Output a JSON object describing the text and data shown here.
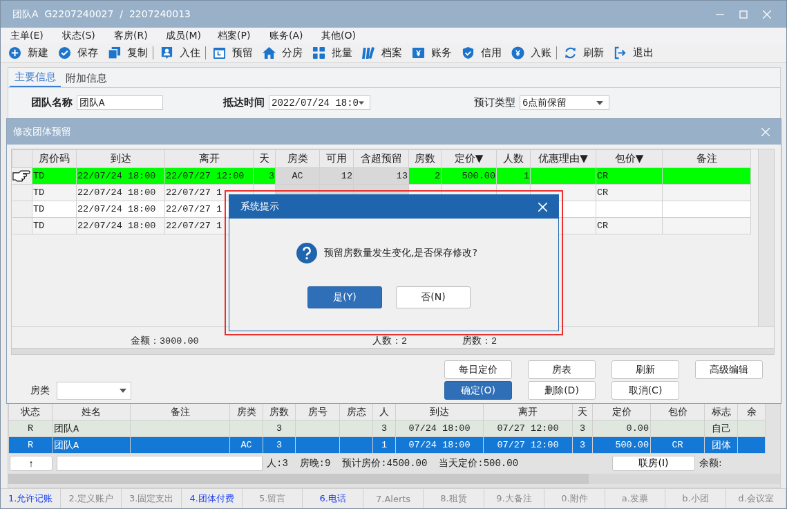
{
  "window": {
    "title": "团队A  G2207240027  /  2207240013"
  },
  "menu": [
    "主单(E)",
    "状态(S)",
    "客房(R)",
    "成员(M)",
    "档案(P)",
    "账务(A)",
    "其他(O)"
  ],
  "toolbar": [
    {
      "label": "新建",
      "divider_after": false
    },
    {
      "label": "保存",
      "divider_after": false
    },
    {
      "label": "复制",
      "divider_after": true
    },
    {
      "label": "入住",
      "divider_after": true
    },
    {
      "label": "预留",
      "divider_after": false
    },
    {
      "label": "分房",
      "divider_after": false
    },
    {
      "label": "批量",
      "divider_after": false
    },
    {
      "label": "档案",
      "divider_after": false
    },
    {
      "label": "账务",
      "divider_after": false
    },
    {
      "label": "信用",
      "divider_after": false
    },
    {
      "label": "入账",
      "divider_after": true
    },
    {
      "label": "刷新",
      "divider_after": false
    },
    {
      "label": "退出",
      "divider_after": false
    }
  ],
  "tabs": [
    {
      "label": "主要信息",
      "selected": true
    },
    {
      "label": "附加信息",
      "selected": false
    }
  ],
  "form": {
    "fields": [
      {
        "label": "团队名称",
        "value": "团队A",
        "bold": true,
        "kind": "text"
      },
      {
        "label": "抵达时间",
        "value": "2022/07/24 18:0",
        "bold": true,
        "kind": "dropdown"
      },
      {
        "label": "预订类型",
        "value": "6点前保留",
        "bold": false,
        "kind": "dropdown"
      }
    ]
  },
  "booking_dialog": {
    "title": "修改团体预留",
    "columns": [
      {
        "label": "房价码",
        "readonly": false
      },
      {
        "label": "到达",
        "readonly": false
      },
      {
        "label": "离开",
        "readonly": false
      },
      {
        "label": "天",
        "readonly": false
      },
      {
        "label": "房类",
        "readonly": true
      },
      {
        "label": "可用",
        "readonly": true
      },
      {
        "label": "含超预留",
        "readonly": true
      },
      {
        "label": "房数",
        "readonly": false
      },
      {
        "label": "定价▼",
        "readonly": false
      },
      {
        "label": "人数",
        "readonly": false
      },
      {
        "label": "优惠理由▼",
        "readonly": false
      },
      {
        "label": "包价▼",
        "readonly": false
      },
      {
        "label": "备注",
        "readonly": false
      }
    ],
    "rows": [
      {
        "selected": true,
        "cells": [
          "TD",
          "22/07/24 18:00",
          "22/07/27 12:00",
          "3",
          "AC",
          "12",
          "13",
          "2",
          "500.00",
          "1",
          null,
          "CR",
          null
        ]
      },
      {
        "selected": false,
        "cells": [
          "TD",
          "22/07/24 18:00",
          "22/07/27 1",
          null,
          null,
          null,
          null,
          null,
          null,
          null,
          null,
          "CR",
          null
        ]
      },
      {
        "selected": false,
        "cells": [
          "TD",
          "22/07/24 18:00",
          "22/07/27 1",
          null,
          null,
          null,
          null,
          null,
          null,
          null,
          null,
          null,
          null
        ]
      },
      {
        "selected": false,
        "cells": [
          "TD",
          "22/07/24 18:00",
          "22/07/27 1",
          null,
          null,
          null,
          null,
          null,
          null,
          null,
          null,
          "CR",
          null
        ]
      }
    ],
    "summary": {
      "amount": "金额：3000.00",
      "people": "人数：2",
      "rooms": "房数：2"
    },
    "room_type_label": "房类",
    "buttons": [
      {
        "label": "每日定价",
        "primary": false
      },
      {
        "label": "房表",
        "primary": false
      },
      {
        "label": "刷新",
        "primary": false
      },
      {
        "label": "高级编辑",
        "primary": false
      },
      {
        "label": "确定(O)",
        "primary": true
      },
      {
        "label": "删除(D)",
        "primary": false
      },
      {
        "label": "取消(C)",
        "primary": false
      }
    ]
  },
  "system_dialog": {
    "title": "系统提示",
    "message": "预留房数量发生变化,是否保存修改?",
    "buttons": [
      {
        "label": "是(Y)",
        "primary": true
      },
      {
        "label": "否(N)",
        "primary": false
      }
    ]
  },
  "guest_grid": {
    "columns": [
      "状态",
      "姓名",
      "备注",
      "房类",
      "房数",
      "房号",
      "房态",
      "人",
      "到达",
      "离开",
      "天",
      "定价",
      "包价",
      "标志",
      "余"
    ],
    "rows": [
      {
        "selected": false,
        "cells": [
          "R",
          "团队A",
          null,
          null,
          "3",
          null,
          null,
          "3",
          "07/24 18:00",
          "07/27 12:00",
          "3",
          "0.00",
          null,
          "自己",
          null
        ]
      },
      {
        "selected": true,
        "cells": [
          "R",
          "团队A",
          null,
          "AC",
          "3",
          null,
          null,
          "1",
          "07/24 18:00",
          "07/27 12:00",
          "3",
          "500.00",
          "CR",
          "团体",
          null
        ]
      }
    ],
    "summary": {
      "up_button": "↑",
      "stats": "人:3  房晚:9  预计房价:4500.00  当天定价:500.00",
      "link_button": "联房(I)",
      "balance_label": "余额:"
    }
  },
  "bottom_tabs": [
    {
      "label": "1.允许记账",
      "highlighted": true
    },
    {
      "label": "2.定义账户",
      "highlighted": false
    },
    {
      "label": "3.固定支出",
      "highlighted": false
    },
    {
      "label": "4.团体付费",
      "highlighted": true
    },
    {
      "label": "5.留言",
      "highlighted": false
    },
    {
      "label": "6.电话",
      "highlighted": true
    },
    {
      "label": "7.Alerts",
      "highlighted": false
    },
    {
      "label": "8.租赁",
      "highlighted": false
    },
    {
      "label": "9.大备注",
      "highlighted": false
    },
    {
      "label": "0.附件",
      "highlighted": false
    },
    {
      "label": "a.发票",
      "highlighted": false
    },
    {
      "label": "b.小团",
      "highlighted": false
    },
    {
      "label": "d.会议室",
      "highlighted": false
    }
  ]
}
